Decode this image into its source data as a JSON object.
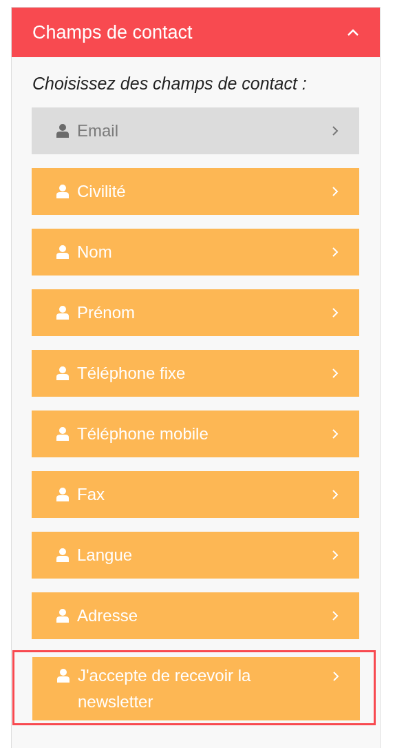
{
  "panel": {
    "title": "Champs de contact",
    "expanded": true
  },
  "prompt": "Choisissez des champs de contact :",
  "fields": [
    {
      "label": "Email",
      "disabled": true,
      "highlighted": false
    },
    {
      "label": "Civilité",
      "disabled": false,
      "highlighted": false
    },
    {
      "label": "Nom",
      "disabled": false,
      "highlighted": false
    },
    {
      "label": "Prénom",
      "disabled": false,
      "highlighted": false
    },
    {
      "label": "Téléphone fixe",
      "disabled": false,
      "highlighted": false
    },
    {
      "label": "Téléphone mobile",
      "disabled": false,
      "highlighted": false
    },
    {
      "label": "Fax",
      "disabled": false,
      "highlighted": false
    },
    {
      "label": "Langue",
      "disabled": false,
      "highlighted": false
    },
    {
      "label": "Adresse",
      "disabled": false,
      "highlighted": false
    },
    {
      "label": "J'accepte de recevoir la newsletter",
      "disabled": false,
      "highlighted": true
    }
  ]
}
